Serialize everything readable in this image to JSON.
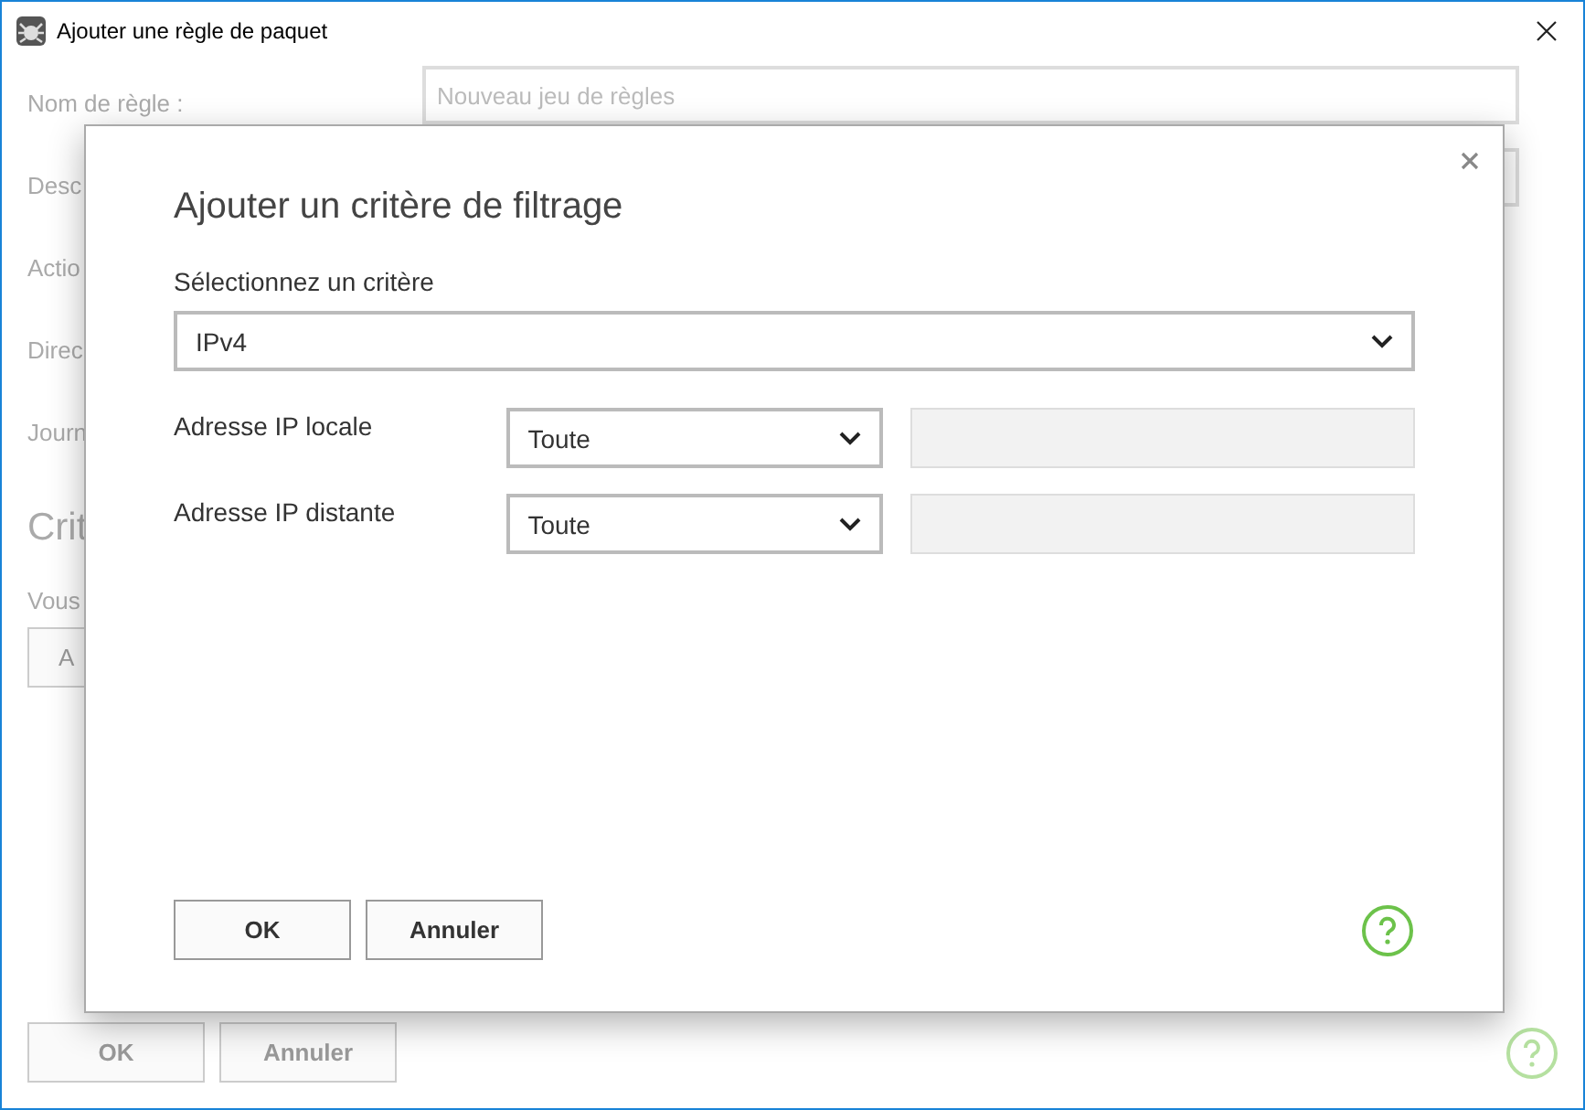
{
  "window": {
    "title": "Ajouter une règle de paquet"
  },
  "background": {
    "fields": [
      {
        "label": "Nom de règle :",
        "placeholder": "Nouveau jeu de règles"
      },
      {
        "label": "Desc"
      },
      {
        "label": "Actio"
      },
      {
        "label": "Direc"
      },
      {
        "label": "Journ"
      }
    ],
    "section_title": "Crit",
    "section_text": "Vous",
    "add_button": "A",
    "buttons": [
      {
        "label": "OK",
        "disabled": true
      },
      {
        "label": "Annuler",
        "disabled": true
      }
    ]
  },
  "dialog": {
    "title": "Ajouter un critère de filtrage",
    "criterion_label": "Sélectionnez un critère",
    "criterion_value": "IPv4",
    "rows": [
      {
        "label": "Adresse IP locale",
        "value": "Toute"
      },
      {
        "label": "Adresse IP distante",
        "value": "Toute"
      }
    ],
    "buttons": [
      {
        "label": "OK",
        "disabled": false
      },
      {
        "label": "Annuler",
        "disabled": false
      }
    ]
  }
}
